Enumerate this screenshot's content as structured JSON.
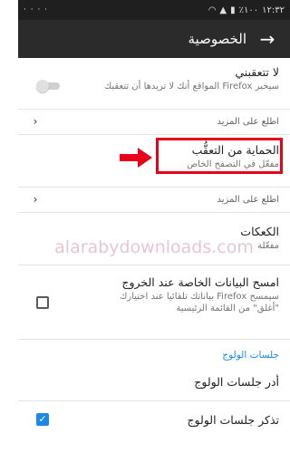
{
  "status_bar": {
    "time": "١٢:٣٢",
    "battery": "١٠٠٪",
    "dots": "· · · ·"
  },
  "app_bar": {
    "title": "الخصوصية",
    "back_icon": "arrow-forward-icon"
  },
  "settings": {
    "do_not_track": {
      "title": "لا تتعقبني",
      "subtitle": "سيخبر Firefox المواقع أنك لا تريدها أن تتعقبك",
      "enabled": false
    },
    "learn_more_1": "اطلع على المزيد",
    "tracking_protection": {
      "title": "الحماية من التعقُّب",
      "subtitle": "مفعّل في التصفح الخاص"
    },
    "learn_more_2": "اطلع على المزيد",
    "cookies": {
      "title": "الكعكات",
      "subtitle": "مفعّلة"
    },
    "clear_on_exit": {
      "title": "امسح البيانات الخاصة عند الخروج",
      "subtitle_line1": "سيمسح Firefox بياناتك تلقائيا عند اختيارك",
      "subtitle_line2": "\"أغلق\" من القائمة الرئيسية",
      "checked": false
    },
    "logins_section_header": "جلسات الولوج",
    "manage_logins": "أدر جلسات الولوج",
    "remember_logins": {
      "title": "تذكر جلسات الولوج",
      "checked": true
    }
  },
  "annotations": {
    "highlight_color": "#e8001a",
    "watermark": "alarabydownloads.com"
  },
  "colors": {
    "appbar": "#2b2b2b",
    "statusbar": "#1f1f1f",
    "accent": "#1e88e5"
  }
}
